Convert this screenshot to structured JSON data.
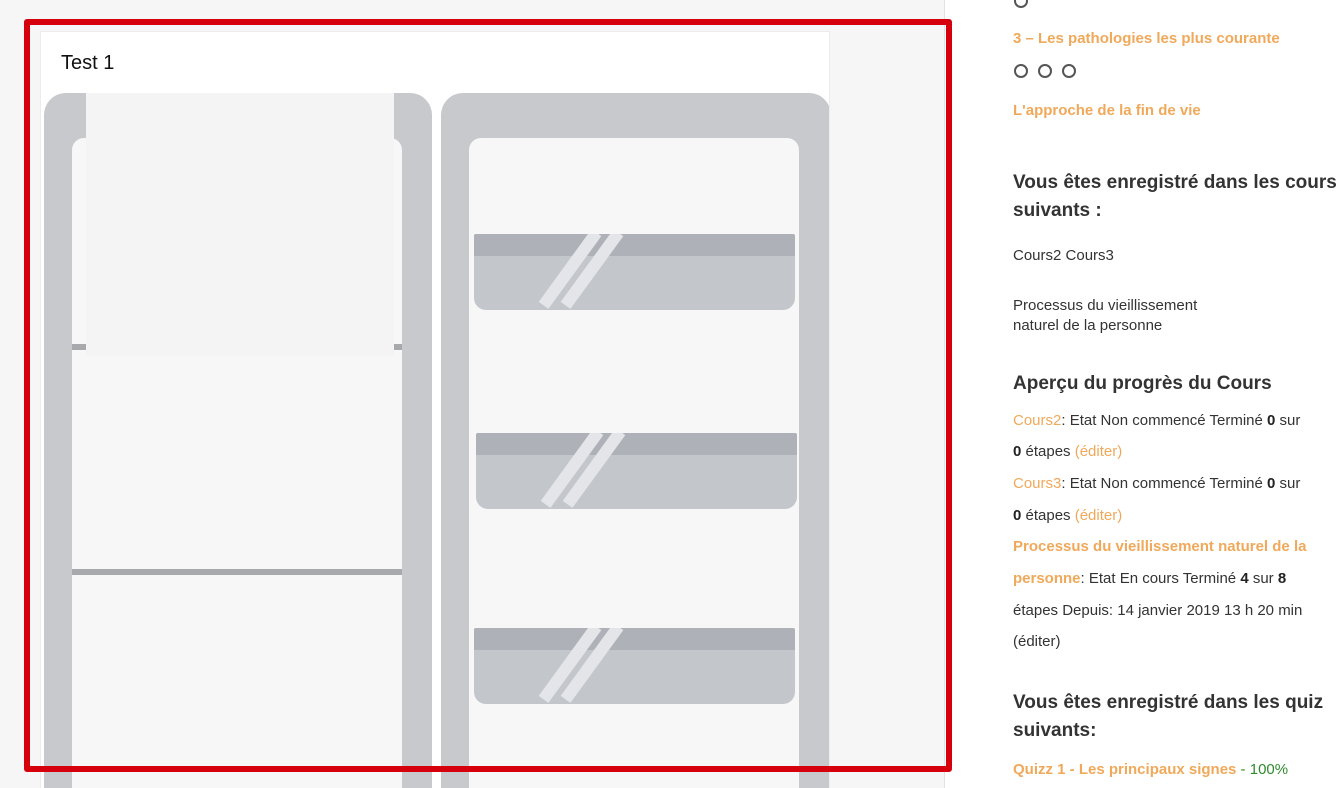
{
  "card": {
    "title": "Test 1"
  },
  "sidebar": {
    "lesson_3_link": "3 – Les pathologies les plus courante",
    "end_of_life_link": "L'approche de la fin de vie",
    "courses_heading_line1": "Vous êtes enregistré dans les cours",
    "courses_heading_line2": "suivants :",
    "courses_list": "Cours2 Cours3",
    "course_process_line1": "Processus du vieillissement",
    "course_process_line2": "naturel de la personne",
    "progress_heading": "Aperçu du progrès du Cours",
    "progress": [
      {
        "course": "Cours2",
        "status_text": ": Etat Non commencé Terminé ",
        "done": "0",
        "sur": " sur",
        "total": "0",
        "steps": " étapes ",
        "edit": "(éditer)"
      },
      {
        "course": "Cours3",
        "status_text": ": Etat Non commencé Terminé ",
        "done": "0",
        "sur": " sur",
        "total": "0",
        "steps": " étapes ",
        "edit": "(éditer)"
      },
      {
        "course_line1": "Processus du vieillissement naturel de la",
        "course_line2": "personne",
        "status_text": ": Etat En cours Terminé ",
        "done": "4",
        "sur": " sur ",
        "total": "8",
        "steps_since": "étapes Depuis: 14 janvier 2019 13 h 20 min",
        "edit": "(éditer)"
      }
    ],
    "quiz_heading_line1": "Vous êtes enregistré dans les quiz",
    "quiz_heading_line2": "suivants:",
    "quiz": {
      "name": "Quizz 1 - Les principaux signes",
      "separator": " - ",
      "score": "100%"
    }
  },
  "colors": {
    "highlight": "#d6000c",
    "accent": "#f0a95a",
    "score": "#2e8b2e"
  }
}
